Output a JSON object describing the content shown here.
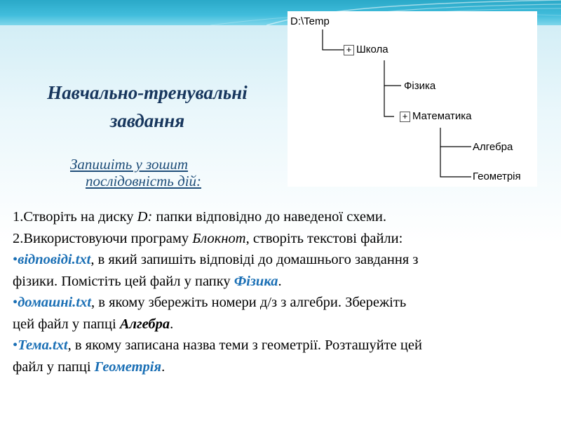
{
  "slide": {
    "title_line1": "Навчально-тренувальні",
    "title_line2": "завдання",
    "subtitle_line1": "Запишіть у зошит",
    "subtitle_line2": "послідовність дій:"
  },
  "tree": {
    "root": "D:\\Temp",
    "school": "Школа",
    "physics": "Фізика",
    "math": "Математика",
    "algebra": "Алгебра",
    "geometry": "Геометрія",
    "expand_symbol": "+"
  },
  "tasks": {
    "t1_prefix": "1.Створіть на диску ",
    "t1_disk": "D:",
    "t1_rest": " папки відповідно до наведеної схеми.",
    "t2_prefix": "2.Використовуючи програму ",
    "t2_app": "Блокнот",
    "t2_rest": ", створіть текстові файли:",
    "bullet": "•",
    "b1_file": "відповіді.txt",
    "b1_text_a": ", в який запишіть відповіді до домашнього завдання з",
    "b1_text_b": "фізики. Помістіть цей файл у папку ",
    "b1_folder": "Фізика",
    "period": ".",
    "b2_file": "домашні.txt",
    "b2_text_a": ", в якому збережіть номери д/з з алгебри. Збережіть",
    "b2_text_b": "цей файл у папці ",
    "b2_folder": "Алгебра",
    "b3_file": "Тема.txt",
    "b3_text_a": ", в якому записана назва теми з геометрії. Розташуйте цей",
    "b3_text_b": "файл у папці ",
    "b3_folder": "Геометрія"
  },
  "colors": {
    "band": "#2aa9c8",
    "title": "#17365d",
    "highlight": "#1a6fb5"
  }
}
